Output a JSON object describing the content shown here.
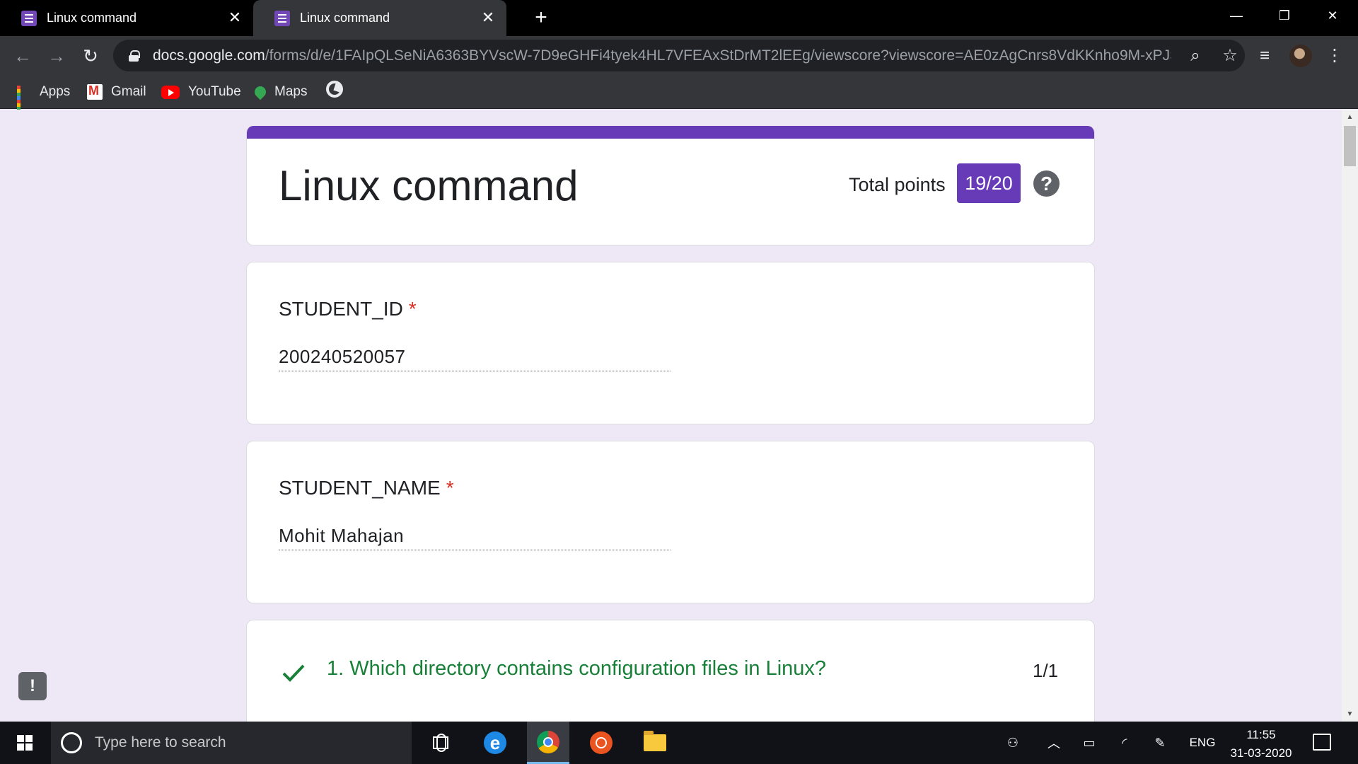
{
  "browser": {
    "tabs": [
      {
        "title": "Linux command",
        "active": false
      },
      {
        "title": "Linux command",
        "active": true
      }
    ],
    "url_host": "docs.google.com",
    "url_path": "/forms/d/e/1FAIpQLSeNiA6363BYVscW-7D9eGHFi4tyek4HL7VFEAxStDrMT2lEEg/viewscore?viewscore=AE0zAgCnrs8VdKKnho9M-xPJSJx...",
    "bookmarks": [
      {
        "label": "Apps",
        "icon": "apps-icon"
      },
      {
        "label": "Gmail",
        "icon": "gmail-icon"
      },
      {
        "label": "YouTube",
        "icon": "youtube-icon"
      },
      {
        "label": "Maps",
        "icon": "maps-icon"
      }
    ]
  },
  "form": {
    "title": "Linux command",
    "total_points_label": "Total points",
    "score": "19/20",
    "accent_color": "#673ab7",
    "questions": [
      {
        "label": "STUDENT_ID",
        "required": "*",
        "answer": "200240520057"
      },
      {
        "label": "STUDENT_NAME",
        "required": "*",
        "answer": "Mohit Mahajan"
      }
    ],
    "graded": [
      {
        "question": "1. Which directory contains configuration files in Linux?",
        "points": "1/1",
        "correct": true,
        "color": "#188038"
      }
    ]
  },
  "taskbar": {
    "search_placeholder": "Type here to search",
    "language": "ENG",
    "time": "11:55",
    "date": "31-03-2020"
  }
}
